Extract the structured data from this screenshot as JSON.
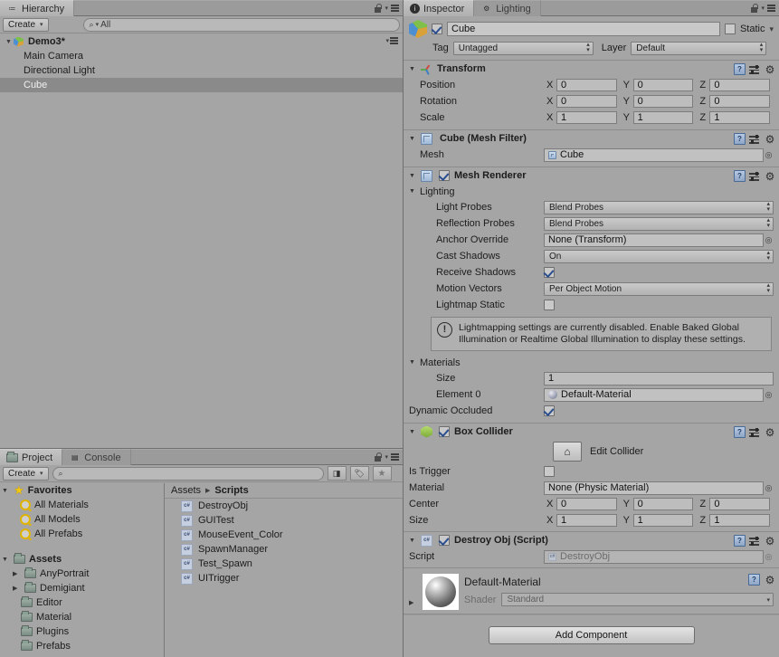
{
  "hierarchy": {
    "tab_label": "Hierarchy",
    "tab_icon": "hierarchy-icon",
    "create_label": "Create",
    "search_placeholder": "All",
    "search_value": "All",
    "scene_name": "Demo3*",
    "items": [
      {
        "label": "Main Camera",
        "selected": false
      },
      {
        "label": "Directional Light",
        "selected": false
      },
      {
        "label": "Cube",
        "selected": true
      }
    ]
  },
  "project": {
    "tab_label": "Project",
    "console_tab_label": "Console",
    "create_label": "Create",
    "search_value": "",
    "favorites_label": "Favorites",
    "favorites": [
      {
        "label": "All Materials"
      },
      {
        "label": "All Models"
      },
      {
        "label": "All Prefabs"
      }
    ],
    "assets_label": "Assets",
    "folders": [
      {
        "label": "AnyPortrait",
        "expandable": true
      },
      {
        "label": "Demigiant",
        "expandable": true
      },
      {
        "label": "Editor",
        "expandable": false
      },
      {
        "label": "Material",
        "expandable": false
      },
      {
        "label": "Plugins",
        "expandable": false
      },
      {
        "label": "Prefabs",
        "expandable": false
      }
    ],
    "breadcrumb_root": "Assets",
    "breadcrumb_current": "Scripts",
    "assets": [
      {
        "label": "DestroyObj"
      },
      {
        "label": "GUITest"
      },
      {
        "label": "MouseEvent_Color"
      },
      {
        "label": "SpawnManager"
      },
      {
        "label": "Test_Spawn"
      },
      {
        "label": "UITrigger"
      }
    ]
  },
  "inspector": {
    "tab_label": "Inspector",
    "lighting_tab_label": "Lighting",
    "game_object": {
      "enabled": true,
      "name": "Cube",
      "static_label": "Static",
      "static_checked": false,
      "tag_label": "Tag",
      "tag_value": "Untagged",
      "layer_label": "Layer",
      "layer_value": "Default"
    },
    "transform": {
      "title": "Transform",
      "rows": [
        {
          "label": "Position",
          "x": "0",
          "y": "0",
          "z": "0"
        },
        {
          "label": "Rotation",
          "x": "0",
          "y": "0",
          "z": "0"
        },
        {
          "label": "Scale",
          "x": "1",
          "y": "1",
          "z": "1"
        }
      ],
      "axis_x": "X",
      "axis_y": "Y",
      "axis_z": "Z"
    },
    "mesh_filter": {
      "title": "Cube (Mesh Filter)",
      "mesh_label": "Mesh",
      "mesh_value": "Cube"
    },
    "mesh_renderer": {
      "title": "Mesh Renderer",
      "enabled": true,
      "lighting_label": "Lighting",
      "light_probes_label": "Light Probes",
      "light_probes_value": "Blend Probes",
      "reflection_probes_label": "Reflection Probes",
      "reflection_probes_value": "Blend Probes",
      "anchor_override_label": "Anchor Override",
      "anchor_override_value": "None (Transform)",
      "cast_shadows_label": "Cast Shadows",
      "cast_shadows_value": "On",
      "receive_shadows_label": "Receive Shadows",
      "receive_shadows_checked": true,
      "motion_vectors_label": "Motion Vectors",
      "motion_vectors_value": "Per Object Motion",
      "lightmap_static_label": "Lightmap Static",
      "lightmap_static_checked": false,
      "help_text": "Lightmapping settings are currently disabled. Enable Baked Global Illumination or Realtime Global Illumination to display these settings.",
      "materials_label": "Materials",
      "size_label": "Size",
      "size_value": "1",
      "element0_label": "Element 0",
      "element0_value": "Default-Material",
      "dynamic_occluded_label": "Dynamic Occluded",
      "dynamic_occluded_checked": true
    },
    "box_collider": {
      "title": "Box Collider",
      "enabled": true,
      "edit_collider_label": "Edit Collider",
      "is_trigger_label": "Is Trigger",
      "is_trigger_checked": false,
      "material_label": "Material",
      "material_value": "None (Physic Material)",
      "center_label": "Center",
      "center": {
        "x": "0",
        "y": "0",
        "z": "0"
      },
      "size_label": "Size",
      "size": {
        "x": "1",
        "y": "1",
        "z": "1"
      },
      "axis_x": "X",
      "axis_y": "Y",
      "axis_z": "Z"
    },
    "script_component": {
      "title": "Destroy Obj (Script)",
      "enabled": true,
      "script_label": "Script",
      "script_value": "DestroyObj"
    },
    "material_preview": {
      "name": "Default-Material",
      "shader_label": "Shader",
      "shader_value": "Standard"
    },
    "add_component_label": "Add Component"
  },
  "colors": {
    "panel_bg": "#a5a5a5",
    "selection": "#8a8a8a",
    "checkbox_check": "#2a4d8f",
    "favorite_star": "#f2c712"
  }
}
